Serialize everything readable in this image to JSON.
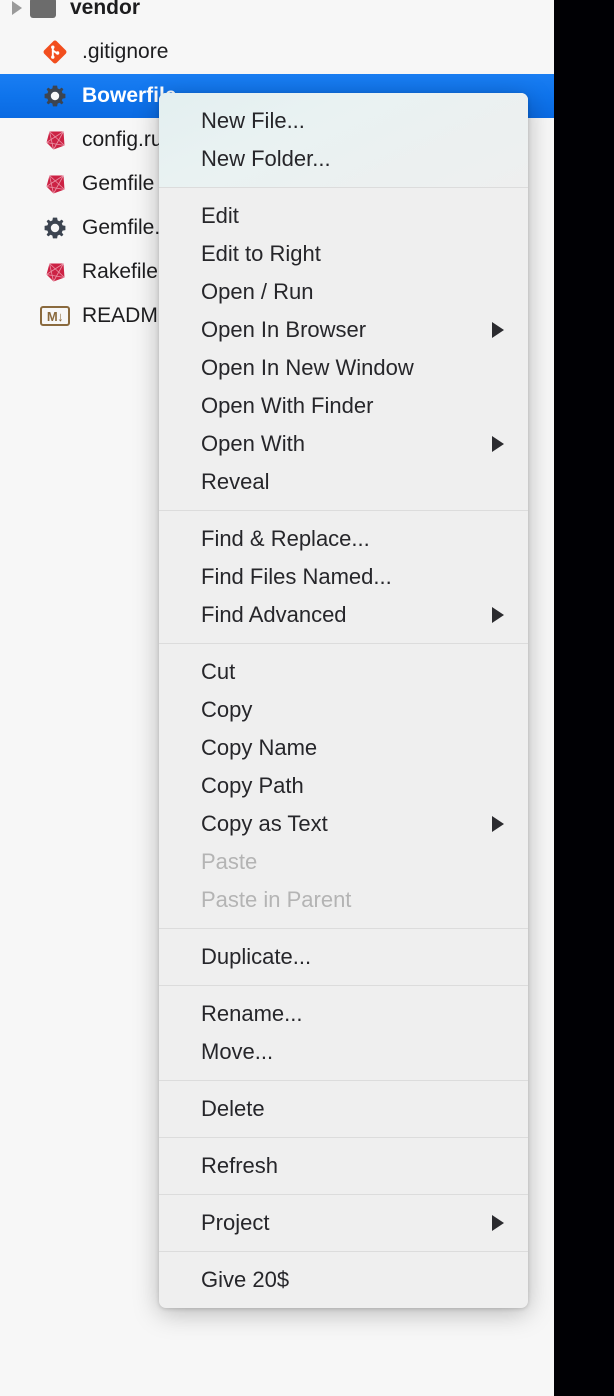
{
  "window": {
    "background_color": "#000004",
    "panel_background": "#f7f7f7",
    "selection_color": "#0f74ec",
    "menu_background": "#efefef",
    "menu_header_tint": "#e6f0f1",
    "disabled_text_color": "#b4b4b4"
  },
  "file_tree": {
    "rows": [
      {
        "label": "vendor",
        "icon": "folder-icon",
        "indent": 0,
        "expandable": true,
        "selected": false,
        "bold": true
      },
      {
        "label": ".gitignore",
        "icon": "git-icon",
        "indent": 1,
        "expandable": false,
        "selected": false,
        "bold": false
      },
      {
        "label": "Bowerfile",
        "icon": "gear-icon",
        "indent": 1,
        "expandable": false,
        "selected": true,
        "bold": true
      },
      {
        "label": "config.ru",
        "icon": "ruby-icon",
        "indent": 1,
        "expandable": false,
        "selected": false,
        "bold": false
      },
      {
        "label": "Gemfile",
        "icon": "ruby-icon",
        "indent": 1,
        "expandable": false,
        "selected": false,
        "bold": false
      },
      {
        "label": "Gemfile.lock",
        "icon": "gear-icon",
        "indent": 1,
        "expandable": false,
        "selected": false,
        "bold": false
      },
      {
        "label": "Rakefile",
        "icon": "ruby-icon",
        "indent": 1,
        "expandable": false,
        "selected": false,
        "bold": false
      },
      {
        "label": "README.md",
        "icon": "markdown-icon",
        "indent": 1,
        "expandable": false,
        "selected": false,
        "bold": false
      }
    ],
    "markdown_icon_glyph": "M↓"
  },
  "context_menu": {
    "sections": [
      {
        "tinted": true,
        "items": [
          {
            "label": "New File...",
            "submenu": false,
            "disabled": false
          },
          {
            "label": "New Folder...",
            "submenu": false,
            "disabled": false
          }
        ]
      },
      {
        "tinted": false,
        "items": [
          {
            "label": "Edit",
            "submenu": false,
            "disabled": false
          },
          {
            "label": "Edit to Right",
            "submenu": false,
            "disabled": false
          },
          {
            "label": "Open / Run",
            "submenu": false,
            "disabled": false
          },
          {
            "label": "Open In Browser",
            "submenu": true,
            "disabled": false
          },
          {
            "label": "Open In New Window",
            "submenu": false,
            "disabled": false
          },
          {
            "label": "Open With Finder",
            "submenu": false,
            "disabled": false
          },
          {
            "label": "Open With",
            "submenu": true,
            "disabled": false
          },
          {
            "label": "Reveal",
            "submenu": false,
            "disabled": false
          }
        ]
      },
      {
        "tinted": false,
        "items": [
          {
            "label": "Find & Replace...",
            "submenu": false,
            "disabled": false
          },
          {
            "label": "Find Files Named...",
            "submenu": false,
            "disabled": false
          },
          {
            "label": "Find Advanced",
            "submenu": true,
            "disabled": false
          }
        ]
      },
      {
        "tinted": false,
        "items": [
          {
            "label": "Cut",
            "submenu": false,
            "disabled": false
          },
          {
            "label": "Copy",
            "submenu": false,
            "disabled": false
          },
          {
            "label": "Copy Name",
            "submenu": false,
            "disabled": false
          },
          {
            "label": "Copy Path",
            "submenu": false,
            "disabled": false
          },
          {
            "label": "Copy as Text",
            "submenu": true,
            "disabled": false
          },
          {
            "label": "Paste",
            "submenu": false,
            "disabled": true
          },
          {
            "label": "Paste in Parent",
            "submenu": false,
            "disabled": true
          }
        ]
      },
      {
        "tinted": false,
        "items": [
          {
            "label": "Duplicate...",
            "submenu": false,
            "disabled": false
          }
        ]
      },
      {
        "tinted": false,
        "items": [
          {
            "label": "Rename...",
            "submenu": false,
            "disabled": false
          },
          {
            "label": "Move...",
            "submenu": false,
            "disabled": false
          }
        ]
      },
      {
        "tinted": false,
        "items": [
          {
            "label": "Delete",
            "submenu": false,
            "disabled": false
          }
        ]
      },
      {
        "tinted": false,
        "items": [
          {
            "label": "Refresh",
            "submenu": false,
            "disabled": false
          }
        ]
      },
      {
        "tinted": false,
        "items": [
          {
            "label": "Project",
            "submenu": true,
            "disabled": false
          }
        ]
      },
      {
        "tinted": false,
        "items": [
          {
            "label": "Give 20$",
            "submenu": false,
            "disabled": false
          }
        ]
      }
    ]
  }
}
